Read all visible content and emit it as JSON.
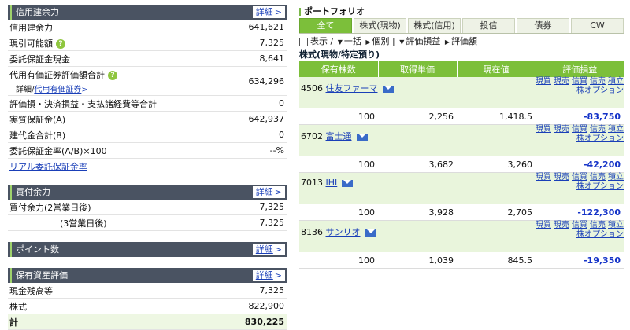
{
  "margin_panel": {
    "header": "信用建余力",
    "detail": "詳細",
    "rows": [
      {
        "label": "信用建余力",
        "value": "641,621"
      },
      {
        "label": "現引可能額",
        "value": "7,325"
      },
      {
        "label": "委託保証金現金",
        "value": "8,641"
      },
      {
        "label": "代用有価証券評価額合計",
        "sub": "詳細/",
        "sub_link": "代用有価証券",
        "value": "634,296"
      },
      {
        "label": "評価損・決済損益・支払諸経費等合計",
        "value": "0"
      },
      {
        "label": "実質保証金(A)",
        "value": "642,937"
      },
      {
        "label": "建代金合計(B)",
        "value": "0"
      },
      {
        "label": "委託保証金率(A/B)×100",
        "value": "--%"
      }
    ],
    "realtime_link": "リアル委託保証金率"
  },
  "buying_panel": {
    "header": "買付余力",
    "detail": "詳細",
    "rows": [
      {
        "label": "買付余力(2営業日後)",
        "value": "7,325"
      },
      {
        "label": "(3営業日後)",
        "value": "7,325"
      }
    ]
  },
  "points_panel": {
    "header": "ポイント数",
    "detail": "詳細"
  },
  "assets_panel": {
    "header": "保有資産評価",
    "detail": "詳細",
    "rows": [
      {
        "label": "現金残高等",
        "value": "7,325"
      },
      {
        "label": "株式",
        "value": "822,900"
      },
      {
        "label": "計",
        "value": "830,225"
      }
    ]
  },
  "portfolio": {
    "title": "ポートフォリオ",
    "tabs": [
      "全て",
      "株式(現物)",
      "株式(信用)",
      "投信",
      "債券",
      "CW"
    ],
    "toolbar": {
      "display": "表示",
      "bulk": "一括",
      "individual": "個別",
      "pl": "評価損益",
      "amount": "評価額"
    },
    "section": "株式(現物/特定預り)",
    "columns": [
      "保有株数",
      "取得単価",
      "現在値",
      "評価損益"
    ],
    "action_links": [
      "現買",
      "現売",
      "信買",
      "信売",
      "積立"
    ],
    "option_link": "株オプション",
    "holdings": [
      {
        "code": "4506",
        "name": "住友ファーマ",
        "qty": "100",
        "cost": "2,256",
        "price": "1,418.5",
        "pl": "-83,750"
      },
      {
        "code": "6702",
        "name": "富士通",
        "qty": "100",
        "cost": "3,682",
        "price": "3,260",
        "pl": "-42,200"
      },
      {
        "code": "7013",
        "name": "IHI",
        "qty": "100",
        "cost": "3,928",
        "price": "2,705",
        "pl": "-122,300"
      },
      {
        "code": "8136",
        "name": "サンリオ",
        "qty": "100",
        "cost": "1,039",
        "price": "845.5",
        "pl": "-19,350"
      }
    ]
  }
}
